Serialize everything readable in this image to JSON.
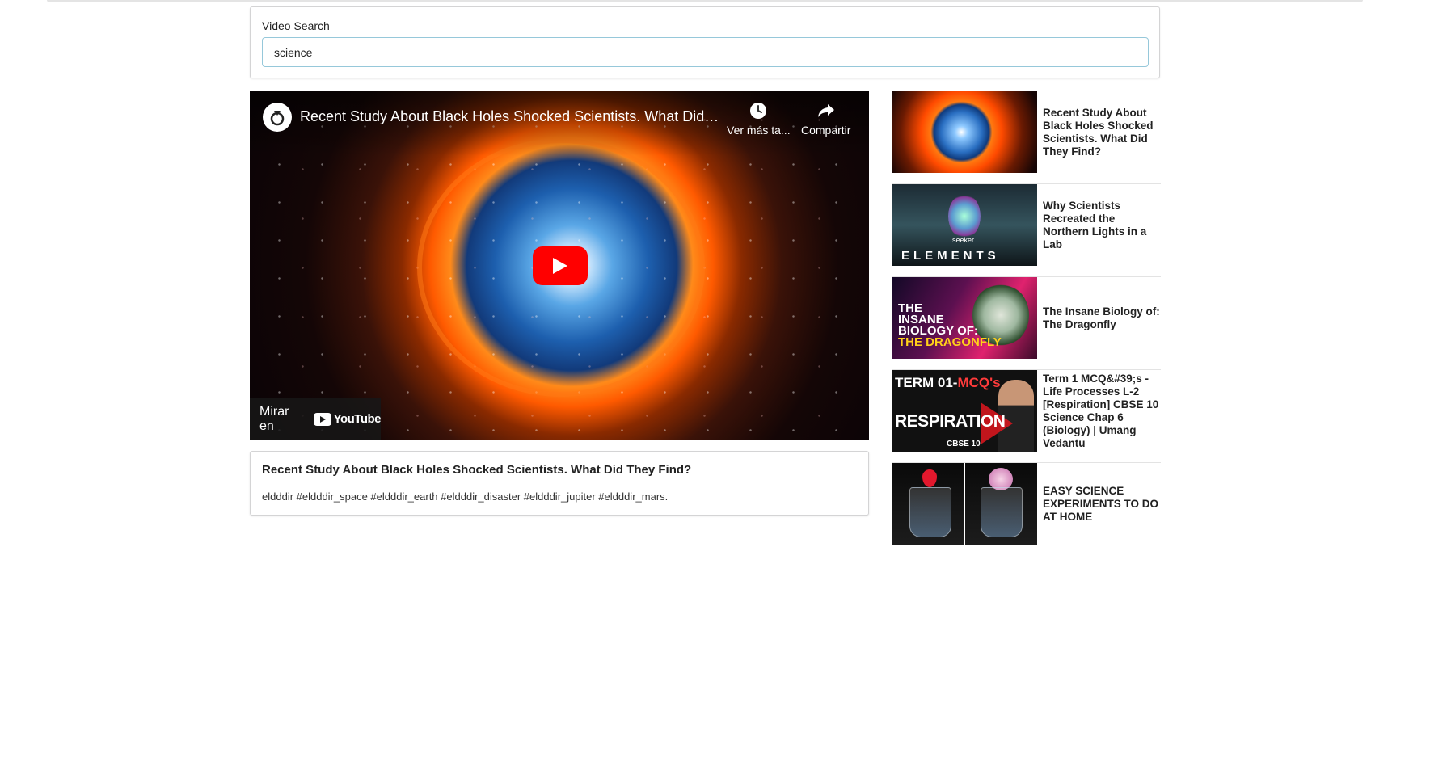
{
  "search": {
    "label": "Video Search",
    "value": "science"
  },
  "player": {
    "title": "Recent Study About Black Holes Shocked Scientists. What Did…",
    "watch_later_label": "Ver más ta...",
    "share_label": "Compartir",
    "watch_on_label": "Mirar en",
    "youtube_logo_text": "YouTube"
  },
  "detail": {
    "title": "Recent Study About Black Holes Shocked Scientists. What Did They Find?",
    "description": "eldddir #eldddir_space #eldddir_earth #eldddir_disaster #eldddir_jupiter #eldddir_mars."
  },
  "videos": [
    {
      "title": "Recent Study About Black Holes Shocked Scientists. What Did They Find?"
    },
    {
      "title": "Why Scientists Recreated the Northern Lights in a Lab",
      "thumb_text": "ELEMENTS",
      "thumb_subtext": "seeker"
    },
    {
      "title": "The Insane Biology of: The Dragonfly",
      "thumb_line1": "THE",
      "thumb_line2": "INSANE",
      "thumb_line3": "BIOLOGY OF:",
      "thumb_line4": "THE DRAGONFLY"
    },
    {
      "title": "Term 1 MCQ&#39;s - Life Processes L-2 [Respiration] CBSE 10 Science Chap 6 (Biology) | Umang Vedantu",
      "thumb_line1a": "TERM 01-",
      "thumb_line1b": "MCQ's",
      "thumb_line2": "RESPIRATION",
      "thumb_line3": "CBSE 10"
    },
    {
      "title": "EASY SCIENCE EXPERIMENTS TO DO AT HOME"
    }
  ],
  "colors": {
    "play_button": "#ff0000",
    "input_border": "#96c8da"
  }
}
